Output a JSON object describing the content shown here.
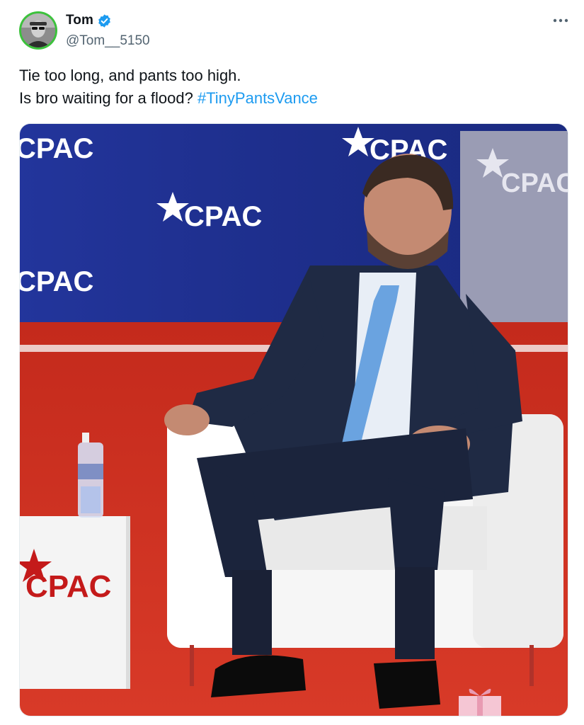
{
  "author": {
    "display_name": "Tom",
    "handle": "@Tom__5150",
    "verified": true,
    "avatar_icon": "user-avatar",
    "badge_color": "#1d9bf0"
  },
  "post": {
    "line1": "Tie too long, and pants too high.",
    "line2_text": "Is bro waiting for a flood?",
    "hashtag": "#TinyPantsVance"
  },
  "menu": {
    "icon": "more-horizontal-icon"
  },
  "media": {
    "backdrop_brand_text": "CPAC",
    "table_brand_text": "CPAC",
    "colors": {
      "backdrop_blue": "#1e2f8c",
      "floor_red": "#d7301f",
      "brand_red": "#c41a1a"
    }
  }
}
